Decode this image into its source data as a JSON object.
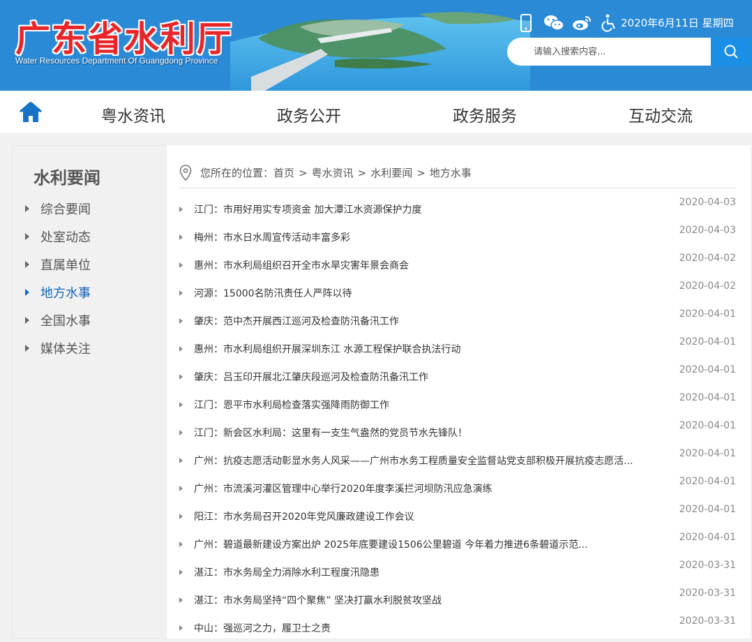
{
  "header": {
    "logo_cn": "广东省水利厅",
    "logo_en": "Water Resources Department Of Guangdong Province",
    "date": "2020年6月11日 星期四",
    "icons": [
      "mobile-icon",
      "wechat-icon",
      "weibo-icon",
      "accessibility-icon"
    ],
    "search_placeholder": "请输入搜索内容..."
  },
  "nav": {
    "items": [
      "粤水资讯",
      "政务公开",
      "政务服务",
      "互动交流"
    ]
  },
  "sidebar": {
    "title": "水利要闻",
    "items": [
      "综合要闻",
      "处室动态",
      "直属单位",
      "地方水事",
      "全国水事",
      "媒体关注"
    ],
    "active_index": 3
  },
  "breadcrumb": {
    "prefix": "您所在的位置：",
    "items": [
      "首页",
      "粤水资讯",
      "水利要闻",
      "地方水事"
    ],
    "separator": ">"
  },
  "news": [
    {
      "title": "江门：市用好用实专项资金 加大潭江水资源保护力度",
      "date": "2020-04-03"
    },
    {
      "title": "梅州：市水日水周宣传活动丰富多彩",
      "date": "2020-04-03"
    },
    {
      "title": "惠州：市水利局组织召开全市水旱灾害年景会商会",
      "date": "2020-04-02"
    },
    {
      "title": "河源：15000名防汛责任人严阵以待",
      "date": "2020-04-02"
    },
    {
      "title": "肇庆：范中杰开展西江巡河及检查防汛备汛工作",
      "date": "2020-04-01"
    },
    {
      "title": "惠州：市水利局组织开展深圳东江 水源工程保护联合执法行动",
      "date": "2020-04-01"
    },
    {
      "title": "肇庆：吕玉印开展北江肇庆段巡河及检查防汛备汛工作",
      "date": "2020-04-01"
    },
    {
      "title": "江门：恩平市水利局检查落实强降雨防御工作",
      "date": "2020-04-01"
    },
    {
      "title": "江门：新会区水利局：这里有一支生气盎然的党员节水先锋队！",
      "date": "2020-04-01"
    },
    {
      "title": "广州：抗疫志愿活动彰显水务人风采——广州市水务工程质量安全监督站党支部积极开展抗疫志愿活...",
      "date": "2020-04-01"
    },
    {
      "title": "广州：市流溪河灌区管理中心举行2020年度李溪拦河坝防汛应急演练",
      "date": "2020-04-01"
    },
    {
      "title": "阳江：市水务局召开2020年党风廉政建设工作会议",
      "date": "2020-04-01"
    },
    {
      "title": "广州：碧道最新建设方案出炉 2025年底要建设1506公里碧道 今年着力推进6条碧道示范...",
      "date": "2020-04-01"
    },
    {
      "title": "湛江：市水务局全力消除水利工程度汛隐患",
      "date": "2020-03-31"
    },
    {
      "title": "湛江：市水务局坚持“四个聚焦” 坚决打赢水利脱贫攻坚战",
      "date": "2020-03-31"
    },
    {
      "title": "中山：强巡河之力，履卫士之责",
      "date": "2020-03-31"
    }
  ]
}
